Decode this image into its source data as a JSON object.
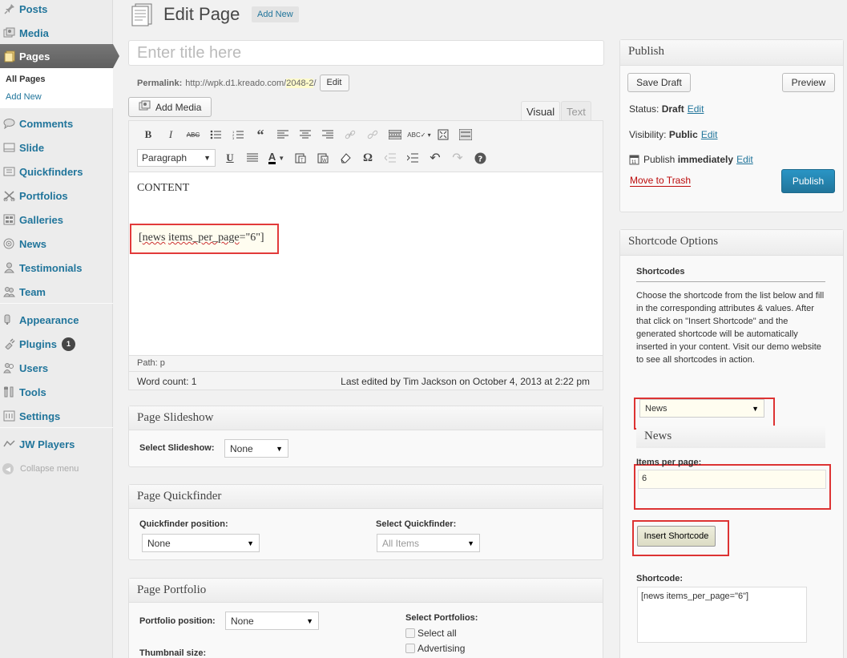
{
  "sidebar": {
    "items": [
      {
        "label": "Posts",
        "icon": "pin-icon"
      },
      {
        "label": "Media",
        "icon": "media-icon"
      },
      {
        "label": "Pages",
        "icon": "pages-icon"
      },
      {
        "label": "Comments",
        "icon": "comment-icon"
      },
      {
        "label": "Slide",
        "icon": "slide-icon"
      },
      {
        "label": "Quickfinders",
        "icon": "quickfinder-icon"
      },
      {
        "label": "Portfolios",
        "icon": "portfolio-icon"
      },
      {
        "label": "Galleries",
        "icon": "gallery-icon"
      },
      {
        "label": "News",
        "icon": "news-icon"
      },
      {
        "label": "Testimonials",
        "icon": "testimonial-icon"
      },
      {
        "label": "Team",
        "icon": "team-icon"
      },
      {
        "label": "Appearance",
        "icon": "appearance-icon"
      },
      {
        "label": "Plugins",
        "icon": "plugin-icon",
        "badge": "1"
      },
      {
        "label": "Users",
        "icon": "users-icon"
      },
      {
        "label": "Tools",
        "icon": "tools-icon"
      },
      {
        "label": "Settings",
        "icon": "settings-icon"
      },
      {
        "label": "JW Players",
        "icon": "jwplayer-icon"
      }
    ],
    "submenu": [
      "All Pages",
      "Add New"
    ],
    "collapse": "Collapse menu"
  },
  "header": {
    "title": "Edit Page",
    "add_new": "Add New"
  },
  "editor": {
    "title_placeholder": "Enter title here",
    "permalink_label": "Permalink:",
    "permalink_base": "http://wpk.d1.kreado.com/",
    "permalink_slug": "2048-2",
    "permalink_trail": "/",
    "permalink_edit": "Edit",
    "add_media": "Add Media",
    "tab_visual": "Visual",
    "tab_text": "Text",
    "format_select": "Paragraph",
    "content_line1": "CONTENT",
    "shortcode_part1": "[",
    "shortcode_wav1": "news",
    "shortcode_space": " ",
    "shortcode_wav2": "items_per_page",
    "shortcode_part2": "=\"6\"]",
    "path": "Path: p",
    "word_count": "Word count: 1",
    "last_edited": "Last edited by Tim Jackson on October 4, 2013 at 2:22 pm"
  },
  "slideshow": {
    "title": "Page Slideshow",
    "select_label": "Select Slideshow:",
    "select_value": "None"
  },
  "quickfinder": {
    "title": "Page Quickfinder",
    "position_label": "Quickfinder position:",
    "position_value": "None",
    "select_label": "Select Quickfinder:",
    "select_value": "All Items"
  },
  "portfolio": {
    "title": "Page Portfolio",
    "position_label": "Portfolio position:",
    "position_value": "None",
    "thumb_label": "Thumbnail size:",
    "select_label": "Select Portfolios:",
    "options": [
      "Select all",
      "Advertising"
    ]
  },
  "publish": {
    "title": "Publish",
    "save_draft": "Save Draft",
    "preview": "Preview",
    "status_label": "Status:",
    "status_value": "Draft",
    "visibility_label": "Visibility:",
    "visibility_value": "Public",
    "publish_label": "Publish",
    "publish_value": "immediately",
    "edit": "Edit",
    "trash": "Move to Trash",
    "publish_btn": "Publish"
  },
  "shortcode_options": {
    "title": "Shortcode Options",
    "subhead": "Shortcodes",
    "description": "Choose the shortcode from the list below and fill in the corresponding attributes & values. After that click on \"Insert Shortcode\" and the generated shortcode will be automatically inserted in your content. Visit our demo website to see all shortcodes in action.",
    "selected": "News",
    "section_title": "News",
    "ipp_label": "Items per page:",
    "ipp_value": "6",
    "insert_btn": "Insert Shortcode",
    "output_label": "Shortcode:",
    "output_value": "[news items_per_page=\"6\"]"
  },
  "colors": {
    "link": "#21759b",
    "highlight": "#e23a3a",
    "publish": "#21759b",
    "trash": "#bc0b0b"
  }
}
